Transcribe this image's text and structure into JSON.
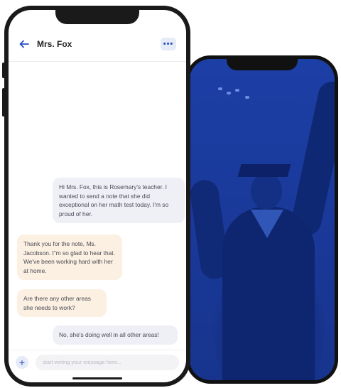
{
  "header": {
    "back_icon": "arrow-left-icon",
    "contact_name": "Mrs. Fox",
    "more_label": "•••"
  },
  "messages": [
    {
      "direction": "outgoing",
      "text": "Hi Mrs. Fox, this is Rosemary's teacher. I wanted to send a note that she did exceptional on her math test today. I'm so proud of her."
    },
    {
      "direction": "incoming",
      "text": "Thank you for the note, Ms. Jacobson. I”m so glad to hear that. We've been working hard with her at home."
    },
    {
      "direction": "incoming",
      "text": "Are there any other areas she needs to work?"
    },
    {
      "direction": "outgoing",
      "text": "No, she's doing well in all other areas!"
    }
  ],
  "composer": {
    "plus_label": "+",
    "placeholder": "start writing your message here..."
  },
  "colors": {
    "accent": "#2a4fc4",
    "outgoing_bubble": "#eef0f6",
    "incoming_bubble": "#fbf0e2",
    "photo_tint": "#1a3a9c"
  }
}
